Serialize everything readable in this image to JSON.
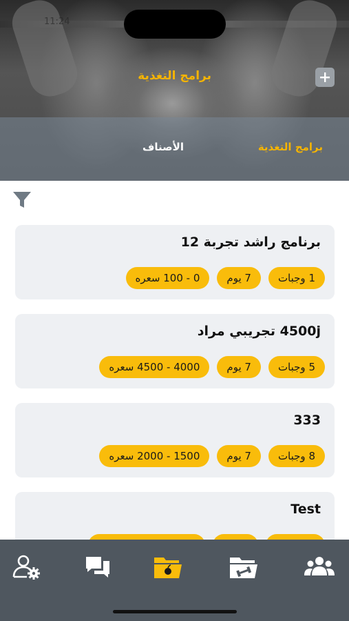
{
  "status": {
    "time": "11:24"
  },
  "header": {
    "title": "برامج التغذية",
    "add_icon": "plus-icon"
  },
  "tabs": [
    {
      "label": "برامج التغذية",
      "active": true
    },
    {
      "label": "الأصناف",
      "active": false
    }
  ],
  "filter_icon": "filter-icon",
  "programs": [
    {
      "title": "برنامج راشد تجربة 12",
      "meals": "1 وجبات",
      "days": "7 يوم",
      "calories": "0 - 100 سعره"
    },
    {
      "title": "4500j تجريبي مراد",
      "meals": "5 وجبات",
      "days": "7 يوم",
      "calories": "4000 - 4500 سعره"
    },
    {
      "title": "333",
      "meals": "8 وجبات",
      "days": "7 يوم",
      "calories": "1500 - 2000 سعره"
    },
    {
      "title": "Test",
      "meals": "",
      "days": "",
      "calories": ""
    }
  ],
  "bottom_nav": [
    {
      "name": "user-settings-icon",
      "active": false
    },
    {
      "name": "chat-icon",
      "active": false
    },
    {
      "name": "nutrition-folder-icon",
      "active": true
    },
    {
      "name": "workout-folder-icon",
      "active": false
    },
    {
      "name": "group-icon",
      "active": false
    }
  ],
  "colors": {
    "accent": "#f9bc0b",
    "card": "#eef0f3",
    "nav_bg": "#4f575f",
    "title_yellow": "#f6b400"
  }
}
